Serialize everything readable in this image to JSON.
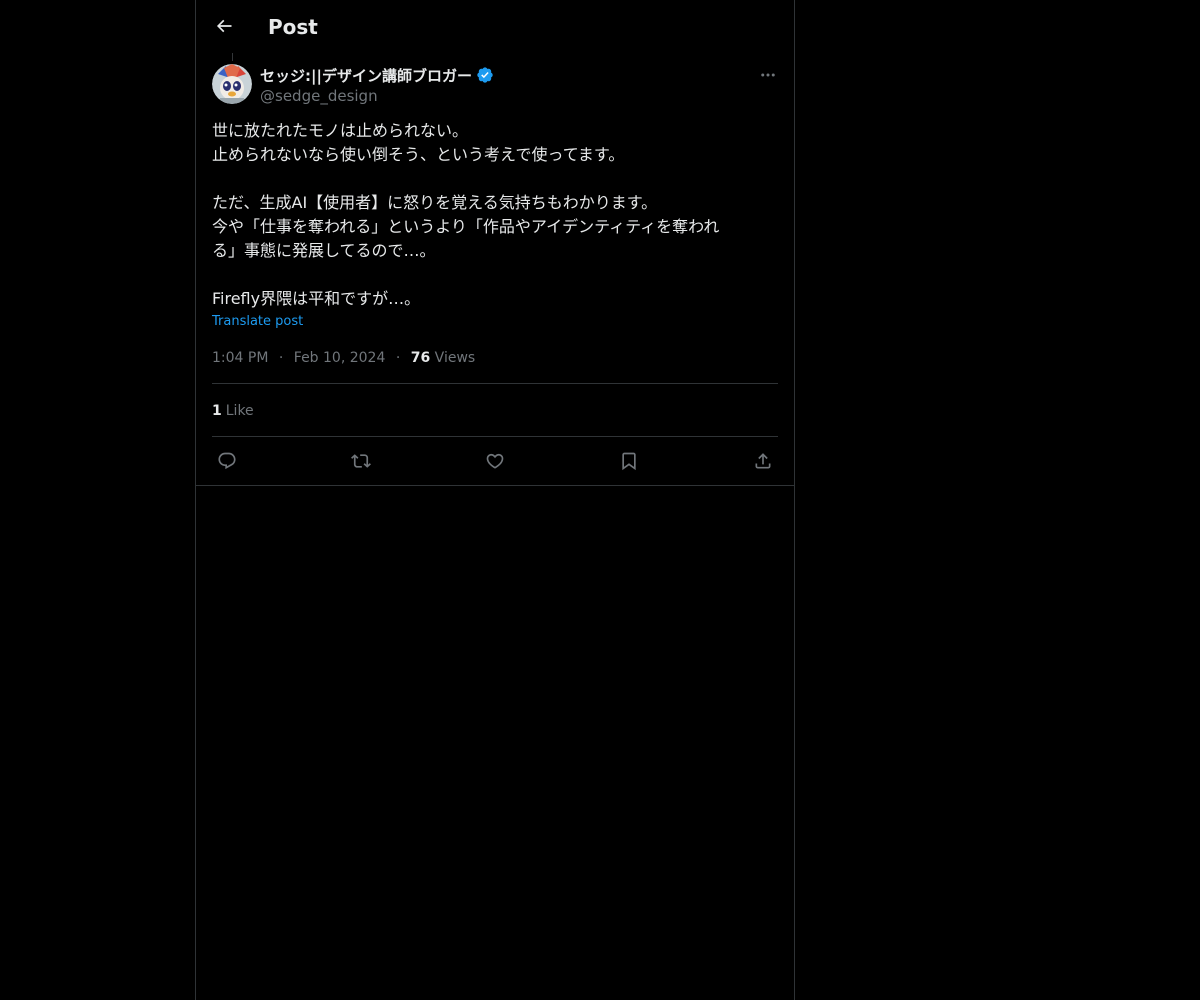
{
  "header": {
    "title": "Post",
    "back_icon": "arrow-left-icon"
  },
  "author": {
    "display_name": "セッジ:||デザイン講師ブロガー",
    "handle": "@sedge_design",
    "verified": true,
    "verified_color": "#1d9bf0"
  },
  "tweet": {
    "lines": [
      "世に放たれたモノは止められない。",
      "止められないなら使い倒そう、という考えで使ってます。",
      "",
      "ただ、生成AI【使用者】に怒りを覚える気持ちもわかります。",
      "今や「仕事を奪われる」というより「作品やアイデンティティを奪われ",
      "る」事態に発展してるので…。",
      "",
      "Firefly界隈は平和ですが…。"
    ],
    "translate_label": "Translate post"
  },
  "meta": {
    "time": "1:04 PM",
    "separator": "·",
    "date": "Feb 10, 2024",
    "views_count": "76",
    "views_label": "Views"
  },
  "engagement": {
    "likes_count": "1",
    "likes_label": "Like"
  },
  "actions": [
    {
      "icon": "reply-icon"
    },
    {
      "icon": "repost-icon"
    },
    {
      "icon": "like-icon"
    },
    {
      "icon": "bookmark-icon"
    },
    {
      "icon": "share-icon"
    }
  ],
  "colors": {
    "background": "#000000",
    "text_primary": "#e7e9ea",
    "text_secondary": "#71767b",
    "accent": "#1d9bf0",
    "border": "#2f3336"
  }
}
